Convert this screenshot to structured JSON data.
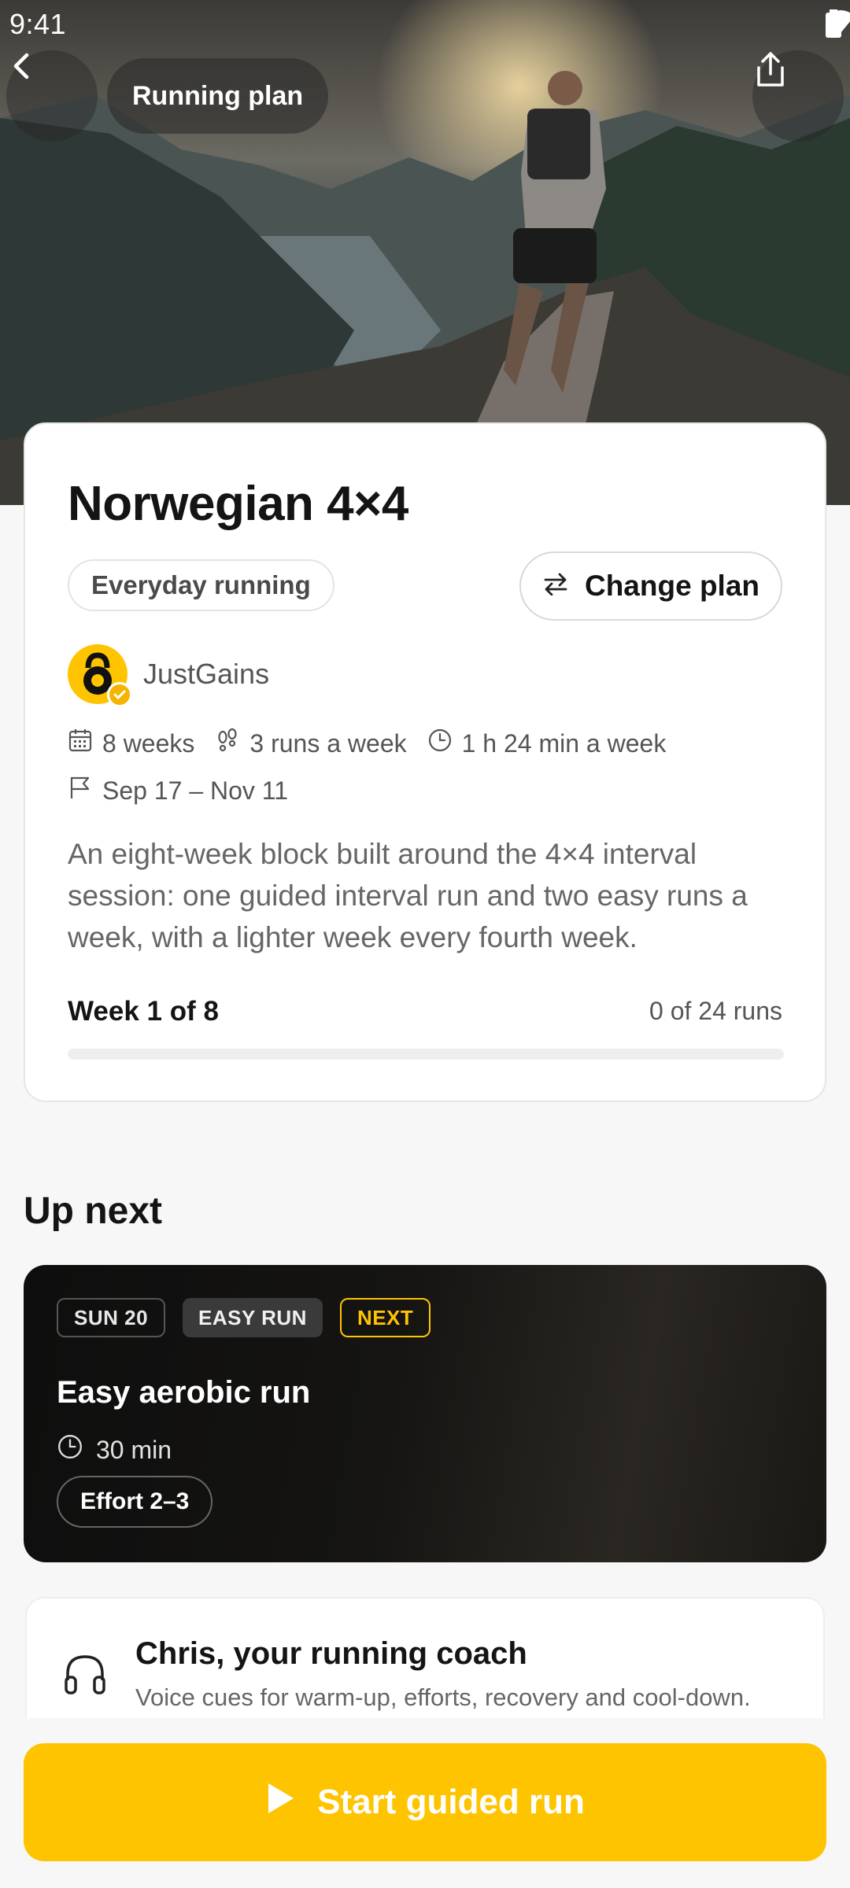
{
  "status_bar": {
    "time": "9:41"
  },
  "header": {
    "title": "Running plan"
  },
  "plan": {
    "title": "Norwegian 4×4",
    "category": "Everyday running",
    "change_plan_label": "Change plan",
    "author": "JustGains",
    "duration_weeks": "8 weeks",
    "runs_per_week": "3 runs a week",
    "time_per_week": "1 h 24 min a week",
    "date_range": "Sep 17 – Nov 11",
    "description": "An eight-week block built around the 4×4 interval session: one guided interval run and two easy runs a week, with a lighter week every fourth week.",
    "week_progress": "Week 1 of 8",
    "runs_progress": "0 of 24 runs",
    "progress_fraction": 0
  },
  "up_next": {
    "section_title": "Up next",
    "date_badge": "SUN 20",
    "type_badge": "EASY RUN",
    "next_badge": "NEXT",
    "title": "Easy aerobic run",
    "duration": "30 min",
    "effort": "Effort 2–3"
  },
  "coach": {
    "title": "Chris, your running coach",
    "subtitle": "Voice cues for warm-up, efforts, recovery and cool-down."
  },
  "cta": {
    "label": "Start guided run"
  },
  "colors": {
    "accent": "#ffc400",
    "dark_card": "#151412"
  },
  "icons": [
    "back-arrow-icon",
    "share-icon",
    "swap-icon",
    "calendar-icon",
    "footprints-icon",
    "clock-icon",
    "flag-icon",
    "headphones-icon",
    "play-icon",
    "wifi-icon",
    "battery-icon",
    "kettlebell-icon",
    "verified-icon"
  ]
}
